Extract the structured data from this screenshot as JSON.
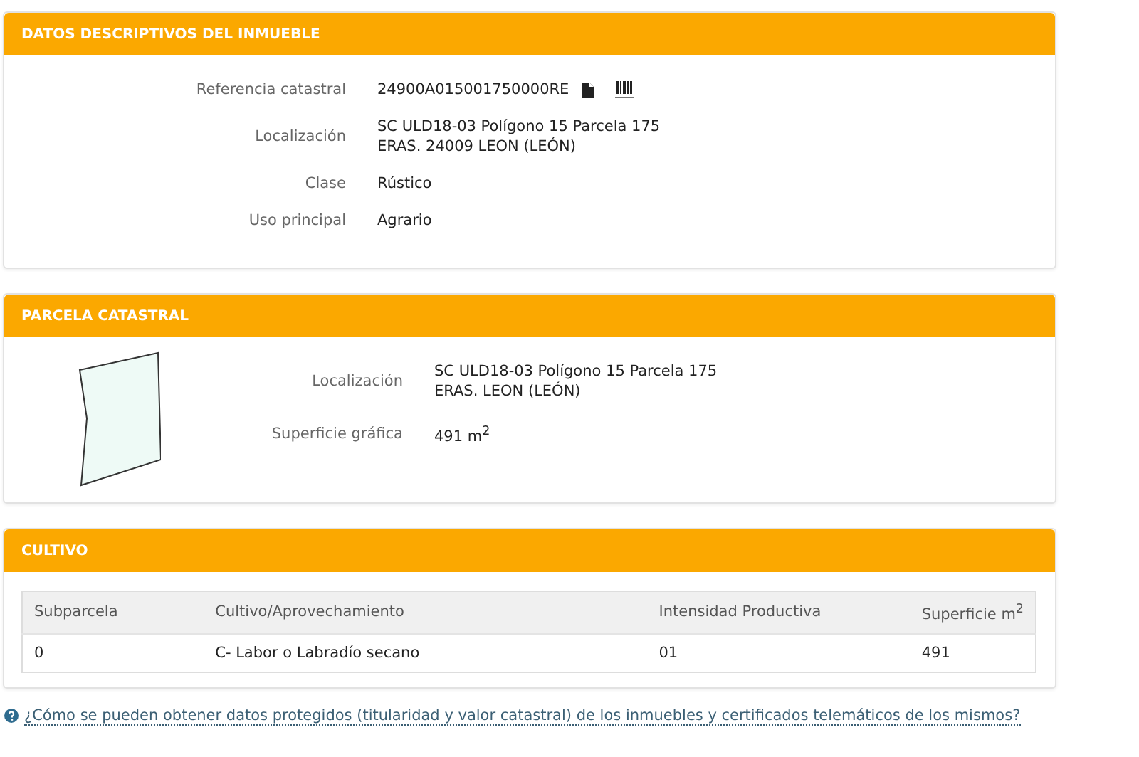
{
  "panels": [
    {
      "kind": "fields",
      "title": "DATOS DESCRIPTIVOS DEL INMUEBLE",
      "fields": [
        {
          "label": "Referencia catastral",
          "lines": [
            "24900A015001750000RE"
          ],
          "kind": "reference"
        },
        {
          "label": "Localización",
          "lines": [
            "SC ULD18-03 Polígono 15 Parcela 175",
            "ERAS. 24009 LEON (LEÓN)"
          ],
          "kind": "text"
        },
        {
          "label": "Clase",
          "lines": [
            "Rústico"
          ],
          "kind": "text"
        },
        {
          "label": "Uso principal",
          "lines": [
            "Agrario"
          ],
          "kind": "text"
        }
      ]
    },
    {
      "kind": "parcel",
      "title": "PARCELA CATASTRAL",
      "fields": [
        {
          "label": "Localización",
          "lines": [
            "SC ULD18-03 Polígono 15 Parcela 175",
            "ERAS. LEON (LEÓN)"
          ],
          "kind": "text"
        },
        {
          "label": "Superficie gráfica",
          "lines": [
            "491 m$^{2}$"
          ],
          "kind": "text"
        }
      ]
    },
    {
      "kind": "table",
      "title": "CULTIVO",
      "columns": [
        "Subparcela",
        "Cultivo/Aprovechamiento",
        "Intensidad Productiva",
        "Superficie m$^{2}$"
      ],
      "rows": [
        [
          "0",
          "C- Labor o Labradío secano",
          "01",
          "491"
        ]
      ]
    }
  ],
  "help_link": "¿Cómo se pueden obtener datos protegidos (titularidad y valor catastral) de los inmuebles y certificados telemáticos de los mismos?"
}
